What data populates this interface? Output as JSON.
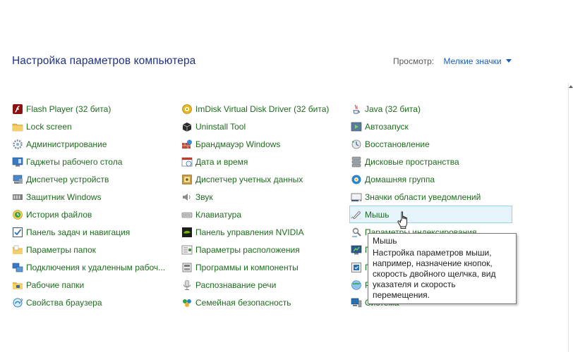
{
  "header": {
    "title": "Настройка параметров компьютера",
    "view_label": "Просмотр:",
    "view_value": "Мелкие значки"
  },
  "columns": [
    [
      {
        "label": "Flash Player (32 бита)",
        "icon": "flash-icon"
      },
      {
        "label": "Lock screen",
        "icon": "folder-icon"
      },
      {
        "label": "Администрирование",
        "icon": "admin-tools-icon"
      },
      {
        "label": "Гаджеты рабочего стола",
        "icon": "gadgets-icon"
      },
      {
        "label": "Диспетчер устройств",
        "icon": "device-manager-icon"
      },
      {
        "label": "Защитник Windows",
        "icon": "defender-icon"
      },
      {
        "label": "История файлов",
        "icon": "file-history-icon"
      },
      {
        "label": "Панель задач и навигация",
        "icon": "taskbar-icon"
      },
      {
        "label": "Параметры папок",
        "icon": "folder-options-icon"
      },
      {
        "label": "Подключения к удаленным рабоч...",
        "icon": "remote-connections-icon"
      },
      {
        "label": "Рабочие папки",
        "icon": "work-folders-icon"
      },
      {
        "label": "Свойства браузера",
        "icon": "browser-properties-icon"
      }
    ],
    [
      {
        "label": "ImDisk Virtual Disk Driver (32 бита)",
        "icon": "imdisk-icon"
      },
      {
        "label": "Uninstall Tool",
        "icon": "uninstall-tool-icon"
      },
      {
        "label": "Брандмауэр Windows",
        "icon": "firewall-icon"
      },
      {
        "label": "Дата и время",
        "icon": "date-time-icon"
      },
      {
        "label": "Диспетчер учетных данных",
        "icon": "credential-manager-icon"
      },
      {
        "label": "Звук",
        "icon": "sound-icon"
      },
      {
        "label": "Клавиатура",
        "icon": "keyboard-icon"
      },
      {
        "label": "Панель управления NVIDIA",
        "icon": "nvidia-icon"
      },
      {
        "label": "Параметры расположения",
        "icon": "location-icon"
      },
      {
        "label": "Программы и компоненты",
        "icon": "programs-icon"
      },
      {
        "label": "Распознавание речи",
        "icon": "speech-icon"
      },
      {
        "label": "Семейная безопасность",
        "icon": "family-safety-icon"
      }
    ],
    [
      {
        "label": "Java (32 бита)",
        "icon": "java-icon"
      },
      {
        "label": "Автозапуск",
        "icon": "autoplay-icon"
      },
      {
        "label": "Восстановление",
        "icon": "recovery-icon"
      },
      {
        "label": "Дисковые пространства",
        "icon": "storage-spaces-icon"
      },
      {
        "label": "Домашняя группа",
        "icon": "homegroup-icon"
      },
      {
        "label": "Значки области уведомлений",
        "icon": "notification-icons-icon"
      },
      {
        "label": "Мышь",
        "icon": "mouse-icon",
        "hovered": true
      },
      {
        "label": "Параметры индексирования",
        "icon": "indexing-icon"
      },
      {
        "label": "П",
        "icon": "power-icon"
      },
      {
        "label": "П",
        "icon": "default-programs-icon"
      },
      {
        "label": "Р",
        "icon": "region-icon"
      },
      {
        "label": "Система",
        "icon": "system-icon"
      }
    ]
  ],
  "tooltip": {
    "title": "Мышь",
    "text": "Настройка параметров мыши, например, назначение кнопок, скорость двойного щелчка, вид указателя и скорость перемещения."
  }
}
